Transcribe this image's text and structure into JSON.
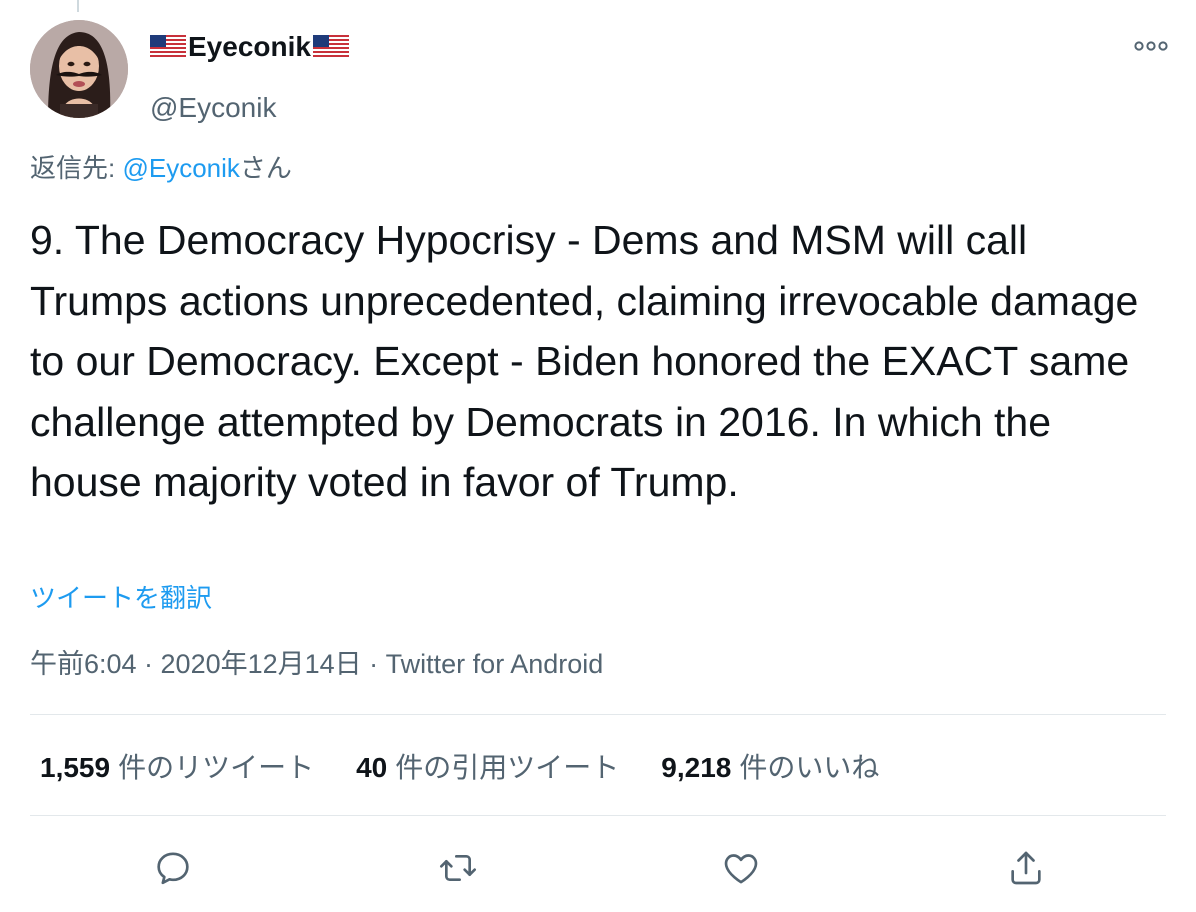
{
  "author": {
    "display_name": "Eyeconik",
    "handle": "@Eyconik",
    "avatar_icon": "avatar-woman-mustache-icon",
    "flag_icon": "us-flag-icon"
  },
  "reply": {
    "prefix": "返信先: ",
    "mention": "@Eyconik",
    "suffix": "さん"
  },
  "tweet": {
    "text": "9. The Democracy Hypocrisy - Dems and MSM will call Trumps actions unprecedented, claiming irrevocable damage to our Democracy. Except - Biden honored the EXACT same challenge attempted by Democrats in 2016. In which the house majority voted in favor of Trump.",
    "translate_label": "ツイートを翻訳",
    "meta": "午前6:04 · 2020年12月14日 · Twitter for Android"
  },
  "stats": {
    "retweets_count": "1,559",
    "retweets_label": "件のリツイート",
    "quotes_count": "40",
    "quotes_label": "件の引用ツイート",
    "likes_count": "9,218",
    "likes_label": "件のいいね"
  },
  "actions": [
    "reply-icon",
    "retweet-icon",
    "like-icon",
    "share-icon"
  ],
  "colors": {
    "text": "#0f1419",
    "secondary": "#536471",
    "link": "#1d9bf0",
    "divider": "#e3e8eb"
  }
}
